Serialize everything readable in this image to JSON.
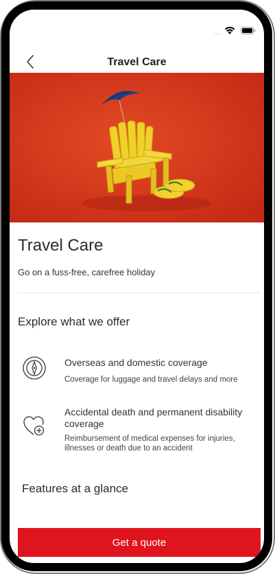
{
  "status_bar": {
    "signal_dots": "....",
    "icons": [
      "wifi-icon",
      "battery-icon"
    ]
  },
  "nav": {
    "back_icon": "chevron-left-icon",
    "title": "Travel Care"
  },
  "hero": {
    "image": "yellow-beach-chair-umbrella-flip-flops",
    "background_color": "#d9391d"
  },
  "product": {
    "title": "Travel Care",
    "subtitle": "Go on a fuss-free, carefree holiday"
  },
  "explore": {
    "title": "Explore what we offer",
    "items": [
      {
        "icon": "compass-icon",
        "title": "Overseas and domestic coverage",
        "description": "Coverage for luggage and travel delays and more"
      },
      {
        "icon": "heart-plus-icon",
        "title": "Accidental death and permanent disability coverage",
        "description": "Reimbursement of medical expenses for injuries, illnesses or death due to an accident"
      }
    ]
  },
  "features": {
    "title": "Features at a glance"
  },
  "cta": {
    "label": "Get a quote",
    "color": "#e0141e"
  }
}
